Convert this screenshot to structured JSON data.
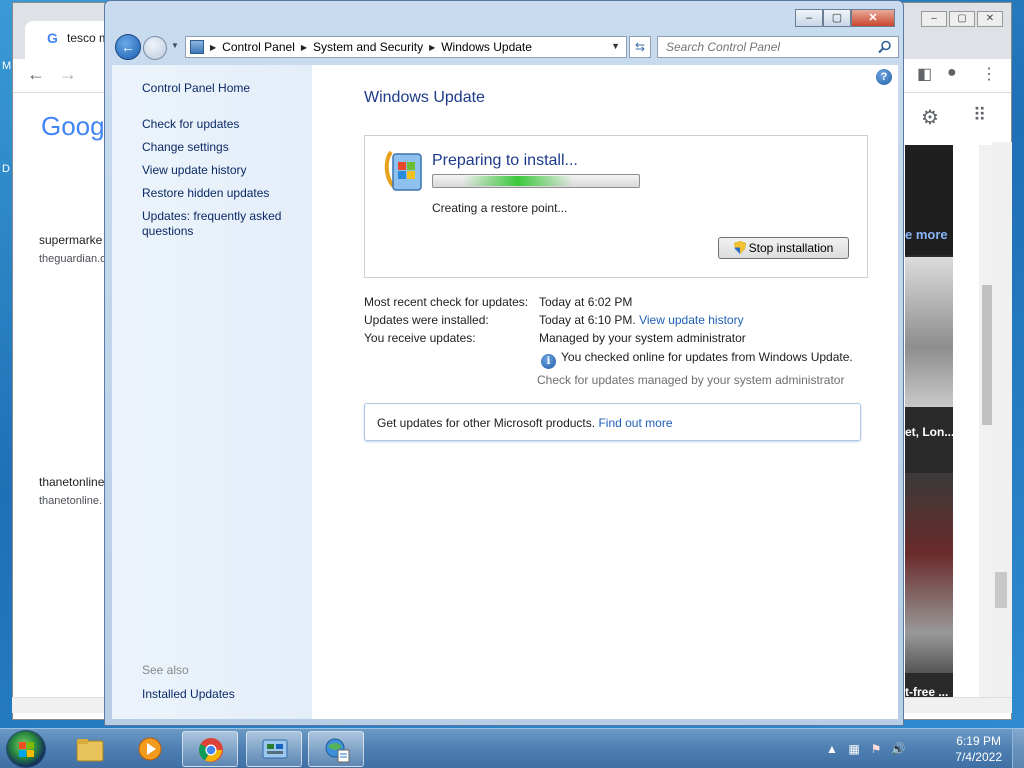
{
  "desktop": {
    "left_labels": [
      "M",
      "D"
    ]
  },
  "chrome": {
    "tab_title": "tesco ma",
    "favicon": "G",
    "logo": "Goog",
    "results": [
      {
        "title": "supermarke",
        "source": "theguardian.c"
      },
      {
        "title": "thanetonline",
        "source": "thanetonline."
      }
    ],
    "side_labels": {
      "more": "e more",
      "caption1": "et, Lon...",
      "caption2": "t-free ..."
    }
  },
  "cp": {
    "breadcrumbs": [
      "Control Panel",
      "System and Security",
      "Windows Update"
    ],
    "search_placeholder": "Search Control Panel",
    "nav": {
      "home": "Control Panel Home",
      "links": [
        "Check for updates",
        "Change settings",
        "View update history",
        "Restore hidden updates",
        "Updates: frequently asked questions"
      ],
      "see_also": "See also",
      "installed": "Installed Updates"
    },
    "title": "Windows Update",
    "status": {
      "heading": "Preparing to install...",
      "progress_indeterminate": true,
      "detail": "Creating a restore point...",
      "stop_button": "Stop installation"
    },
    "info": {
      "recent_label": "Most recent check for updates:",
      "recent_value": "Today at 6:02 PM",
      "installed_label": "Updates were installed:",
      "installed_value": "Today at 6:10 PM.",
      "history_link": "View update history",
      "receive_label": "You receive updates:",
      "receive_value": "Managed by your system administrator",
      "online_note": "You checked online for updates from Windows Update.",
      "managed_sub": "Check for updates managed by your system administrator"
    },
    "ms_products": {
      "text": "Get updates for other Microsoft products.",
      "link": "Find out more"
    },
    "help_symbol": "?"
  },
  "taskbar": {
    "items": [
      "windows-explorer",
      "media-player",
      "chrome",
      "control-panel",
      "windows-update"
    ],
    "time": "6:19 PM",
    "date": "7/4/2022"
  },
  "colors": {
    "title_blue": "#1e3a8a",
    "link_blue": "#1e5fb8",
    "progress_green": "#3cc83c"
  }
}
